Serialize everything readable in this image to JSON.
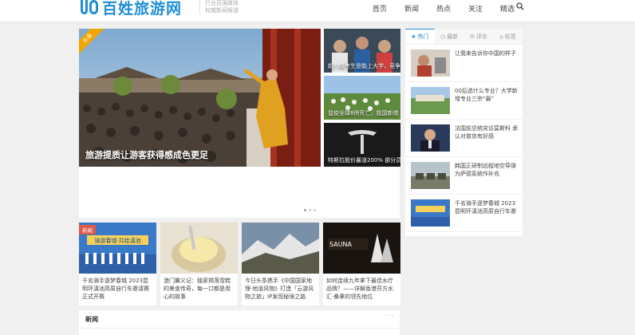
{
  "header": {
    "logo_text": "百姓旅游网",
    "slogan_line1": "行业百强媒体",
    "slogan_line2": "权威新闻报道",
    "nav": [
      "首页",
      "新闻",
      "热点",
      "关注",
      "精选"
    ]
  },
  "slider": {
    "ribbon": "头条",
    "caption": "旅游提质让游客获得感成色更足"
  },
  "side_thumbs": [
    {
      "caption": "超八成考生是能上大学，竞争"
    },
    {
      "caption": "鼠疫全球8例死亡，我国新增"
    },
    {
      "caption": "特斯拉股价暴涨200% 部分员"
    }
  ],
  "cards": [
    {
      "badge": "新闻",
      "title": "千名骑手逐梦春城 2023昆明环滇池高原自行车邀请赛正式开赛",
      "banner": "骑游春城·共绘滇池"
    },
    {
      "badge": "",
      "title": "澳门翼义记：独家揭落雪糕的美食传奇，每一口都是用心的故事"
    },
    {
      "badge": "",
      "title": "今日头条携手《中国国家地理·地道风物》打造「云游风物之旅」IP发现秘境之路"
    },
    {
      "badge": "",
      "title": "如何连续九年拿下最佳水疗品牌？——详解香港芬方水汇·桑拿的领先地位",
      "logo": "SAUNA"
    }
  ],
  "bottom": {
    "title": "新闻",
    "more": "···"
  },
  "sidebar": {
    "tabs": [
      {
        "label": "热门",
        "icon": "star-icon"
      },
      {
        "label": "最新",
        "icon": "clock-icon"
      },
      {
        "label": "评论",
        "icon": "comment-icon"
      },
      {
        "label": "标签",
        "icon": "tag-icon"
      }
    ],
    "items": [
      {
        "title": "让我来告诉你中国的样子"
      },
      {
        "title": "00后选什么专业？大学新增专业三宗“最”"
      },
      {
        "title": "法国前总统突访莫斯科 承认对普京有好感"
      },
      {
        "title": "韩国正研制远程地空导弹 为萨德系统作补充"
      },
      {
        "title": "千名骑手逐梦春城 2023昆明环滇池高原自行车邀"
      }
    ]
  },
  "colors": {
    "accent": "#1f8fd6",
    "ribbon": "#f0a500",
    "badge": "#e05a4a"
  }
}
